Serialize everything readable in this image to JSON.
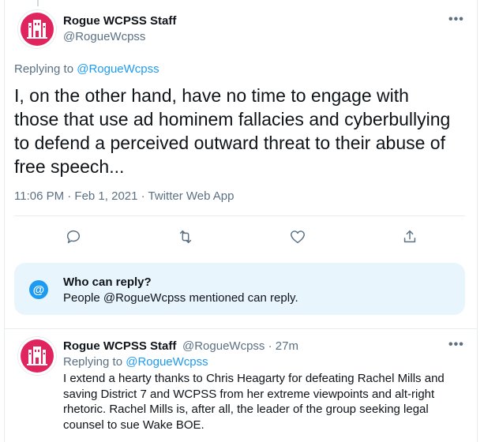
{
  "main_tweet": {
    "display_name": "Rogue WCPSS Staff",
    "handle": "@RogueWcpss",
    "more_label": "•••",
    "replying_prefix": "Replying to",
    "replying_to": "@RogueWcpss",
    "text": "I, on the other hand, have no time to engage with those that use ad hominem fallacies and cyberbullying to defend a perceived outward threat to their abuse of free speech...",
    "timestamp": "11:06 PM · Feb 1, 2021 · Twitter Web App"
  },
  "actions": {
    "icons": [
      "reply-icon",
      "retweet-icon",
      "like-icon",
      "share-icon"
    ]
  },
  "who_can_reply": {
    "icon_glyph": "@",
    "title": "Who can reply?",
    "subtitle": "People @RogueWcpss mentioned can reply."
  },
  "reply_tweet": {
    "display_name": "Rogue WCPSS Staff",
    "handle_time": "@RogueWcpss · 27m",
    "more_label": "•••",
    "replying_prefix": "Replying to",
    "replying_to": "@RogueWcpss",
    "text": "I extend a hearty thanks to Chris Heagarty for defeating Rachel Mills and saving District 7 and WCPSS from her extreme viewpoints and alt-right rhetoric. Rachel Mills is, after all, the leader of the group seeking legal counsel to sue Wake BOE."
  },
  "colors": {
    "accent": "#1d9bf0",
    "brand_avatar": "#e0245e",
    "muted": "#5b7083"
  }
}
